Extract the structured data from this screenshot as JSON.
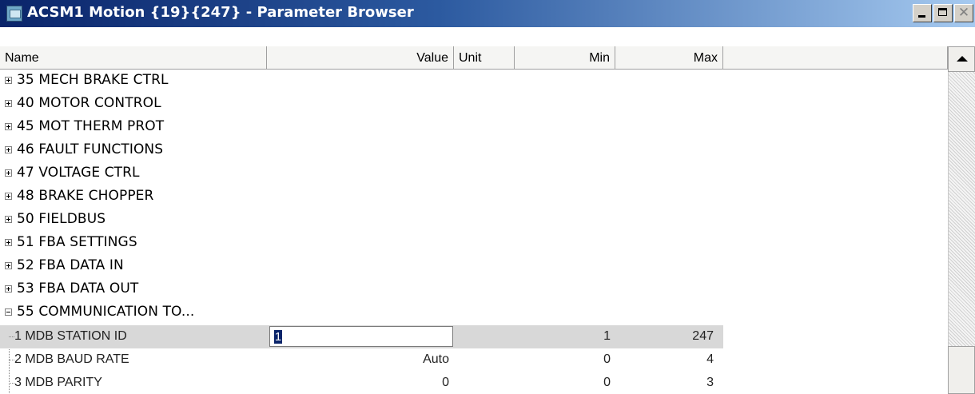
{
  "window": {
    "title": "ACSM1 Motion {19}{247} - Parameter Browser",
    "controls": {
      "minimize": "_",
      "maximize": "□",
      "close": "✕"
    },
    "accent_color": "#0a246a"
  },
  "columns": {
    "name": "Name",
    "value": "Value",
    "unit": "Unit",
    "min": "Min",
    "max": "Max"
  },
  "groups": [
    {
      "label": "35  MECH BRAKE CTRL",
      "expanded": false
    },
    {
      "label": "40  MOTOR CONTROL",
      "expanded": false
    },
    {
      "label": "45  MOT THERM PROT",
      "expanded": false
    },
    {
      "label": "46  FAULT FUNCTIONS",
      "expanded": false
    },
    {
      "label": "47  VOLTAGE CTRL",
      "expanded": false
    },
    {
      "label": "48  BRAKE CHOPPER",
      "expanded": false
    },
    {
      "label": "50  FIELDBUS",
      "expanded": false
    },
    {
      "label": "51  FBA SETTINGS",
      "expanded": false
    },
    {
      "label": "52  FBA DATA IN",
      "expanded": false
    },
    {
      "label": "53  FBA DATA OUT",
      "expanded": false
    },
    {
      "label": "55  COMMUNICATION TO...",
      "expanded": true
    }
  ],
  "params": [
    {
      "name": "1  MDB STATION ID",
      "value": "1",
      "unit": "",
      "min": "1",
      "max": "247",
      "editing": true
    },
    {
      "name": "2  MDB BAUD RATE",
      "value": "Auto",
      "unit": "",
      "min": "0",
      "max": "4",
      "editing": false
    },
    {
      "name": "3  MDB PARITY",
      "value": "0",
      "unit": "",
      "min": "0",
      "max": "3",
      "editing": false
    }
  ]
}
